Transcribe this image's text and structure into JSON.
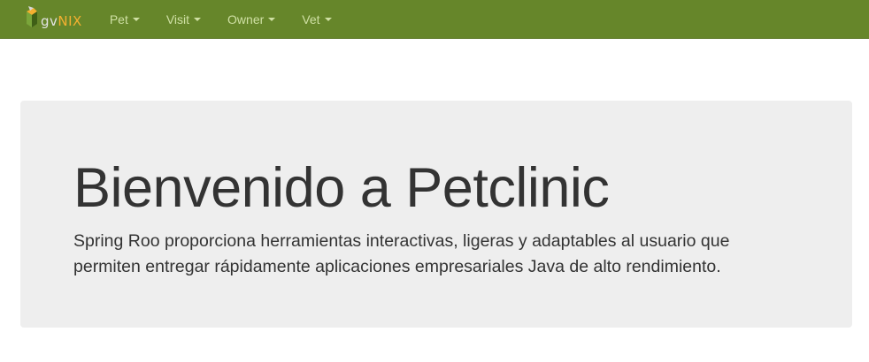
{
  "navbar": {
    "brand": {
      "gv": "gv",
      "nix": "NIX"
    },
    "items": [
      {
        "label": "Pet"
      },
      {
        "label": "Visit"
      },
      {
        "label": "Owner"
      },
      {
        "label": "Vet"
      }
    ],
    "colors": {
      "background": "#66862a",
      "link": "#cfe0a4",
      "brand_accent": "#f4b030"
    }
  },
  "jumbotron": {
    "title": "Bienvenido a Petclinic",
    "text": "Spring Roo proporciona herramientas interactivas, ligeras y adaptables al usuario que permiten entregar rápidamente aplicaciones empresariales Java de alto rendimiento.",
    "background": "#eeeeee"
  }
}
